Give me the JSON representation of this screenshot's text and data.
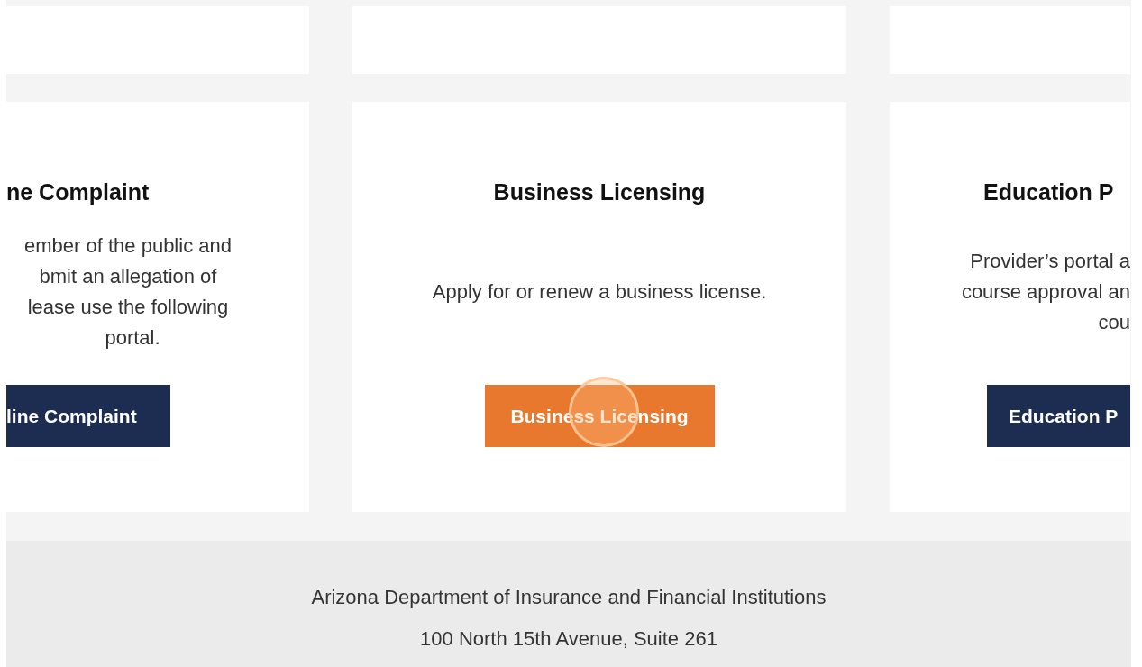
{
  "cards": [
    {
      "title": "ne Complaint",
      "description": [
        "ember of the public and",
        "bmit an allegation of",
        "lease use the following",
        "portal."
      ],
      "button": {
        "label": "line Complaint",
        "highlighted": false
      }
    },
    {
      "title": "Business Licensing",
      "description": [
        "Apply for or renew a business license."
      ],
      "button": {
        "label": "Business Licensing",
        "highlighted": true
      }
    },
    {
      "title": "Education P",
      "description": [
        "Provider’s portal a",
        "course approval an",
        "cou"
      ],
      "button": {
        "label": "Education P",
        "highlighted": false
      }
    }
  ],
  "footer": {
    "lines": [
      "Arizona Department of Insurance and Financial Institutions",
      "100 North 15th Avenue, Suite 261"
    ]
  }
}
